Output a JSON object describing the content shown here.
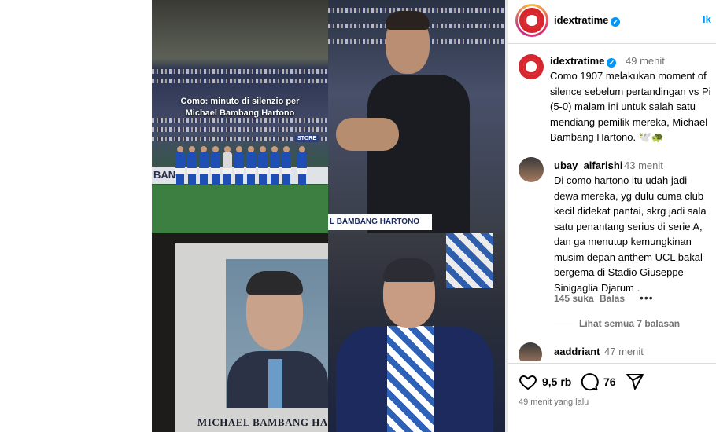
{
  "media": {
    "overlay_caption": "Como: minuto di silenzio per\nMichael Bambang Hartono",
    "ad_board_text": "BANG",
    "store_sign": "STORE",
    "nameplate": "L BAMBANG HARTONO",
    "portrait_caption": "MICHAEL BAMBANG HAI"
  },
  "header": {
    "username": "idextratime",
    "link": "Ik"
  },
  "post": {
    "username": "idextratime",
    "time": "49 menit",
    "caption": "Como 1907 melakukan moment of\nsilence sebelum pertandingan vs Pi\n(5-0) malam ini untuk salah satu\nmendiang pemilik mereka, Michael\nBambang Hartono. 🕊️🐢"
  },
  "comments": [
    {
      "username": "ubay_alfarishi",
      "time": "43 menit",
      "text": "Di como hartono itu udah jadi\ndewa mereka, yg dulu cuma club\nkecil didekat pantai, skrg jadi sala\nsatu penantang serius di serie A,\ndan ga menutup kemungkinan\nmusim depan anthem UCL bakal\nbergema di Stadio Giuseppe\nSinigaglia Djarum .",
      "likes": "145 suka",
      "reply": "Balas",
      "more": "•••",
      "view_replies": "Lihat semua 7 balasan"
    },
    {
      "username": "aaddriant",
      "time": "47 menit"
    }
  ],
  "actions": {
    "likes_count": "9,5 rb",
    "comments_count": "76",
    "posted_ago": "49 menit yang lalu"
  },
  "colors": {
    "brand_red": "#d7262e",
    "verified_blue": "#0095f6",
    "muted": "#737373"
  }
}
